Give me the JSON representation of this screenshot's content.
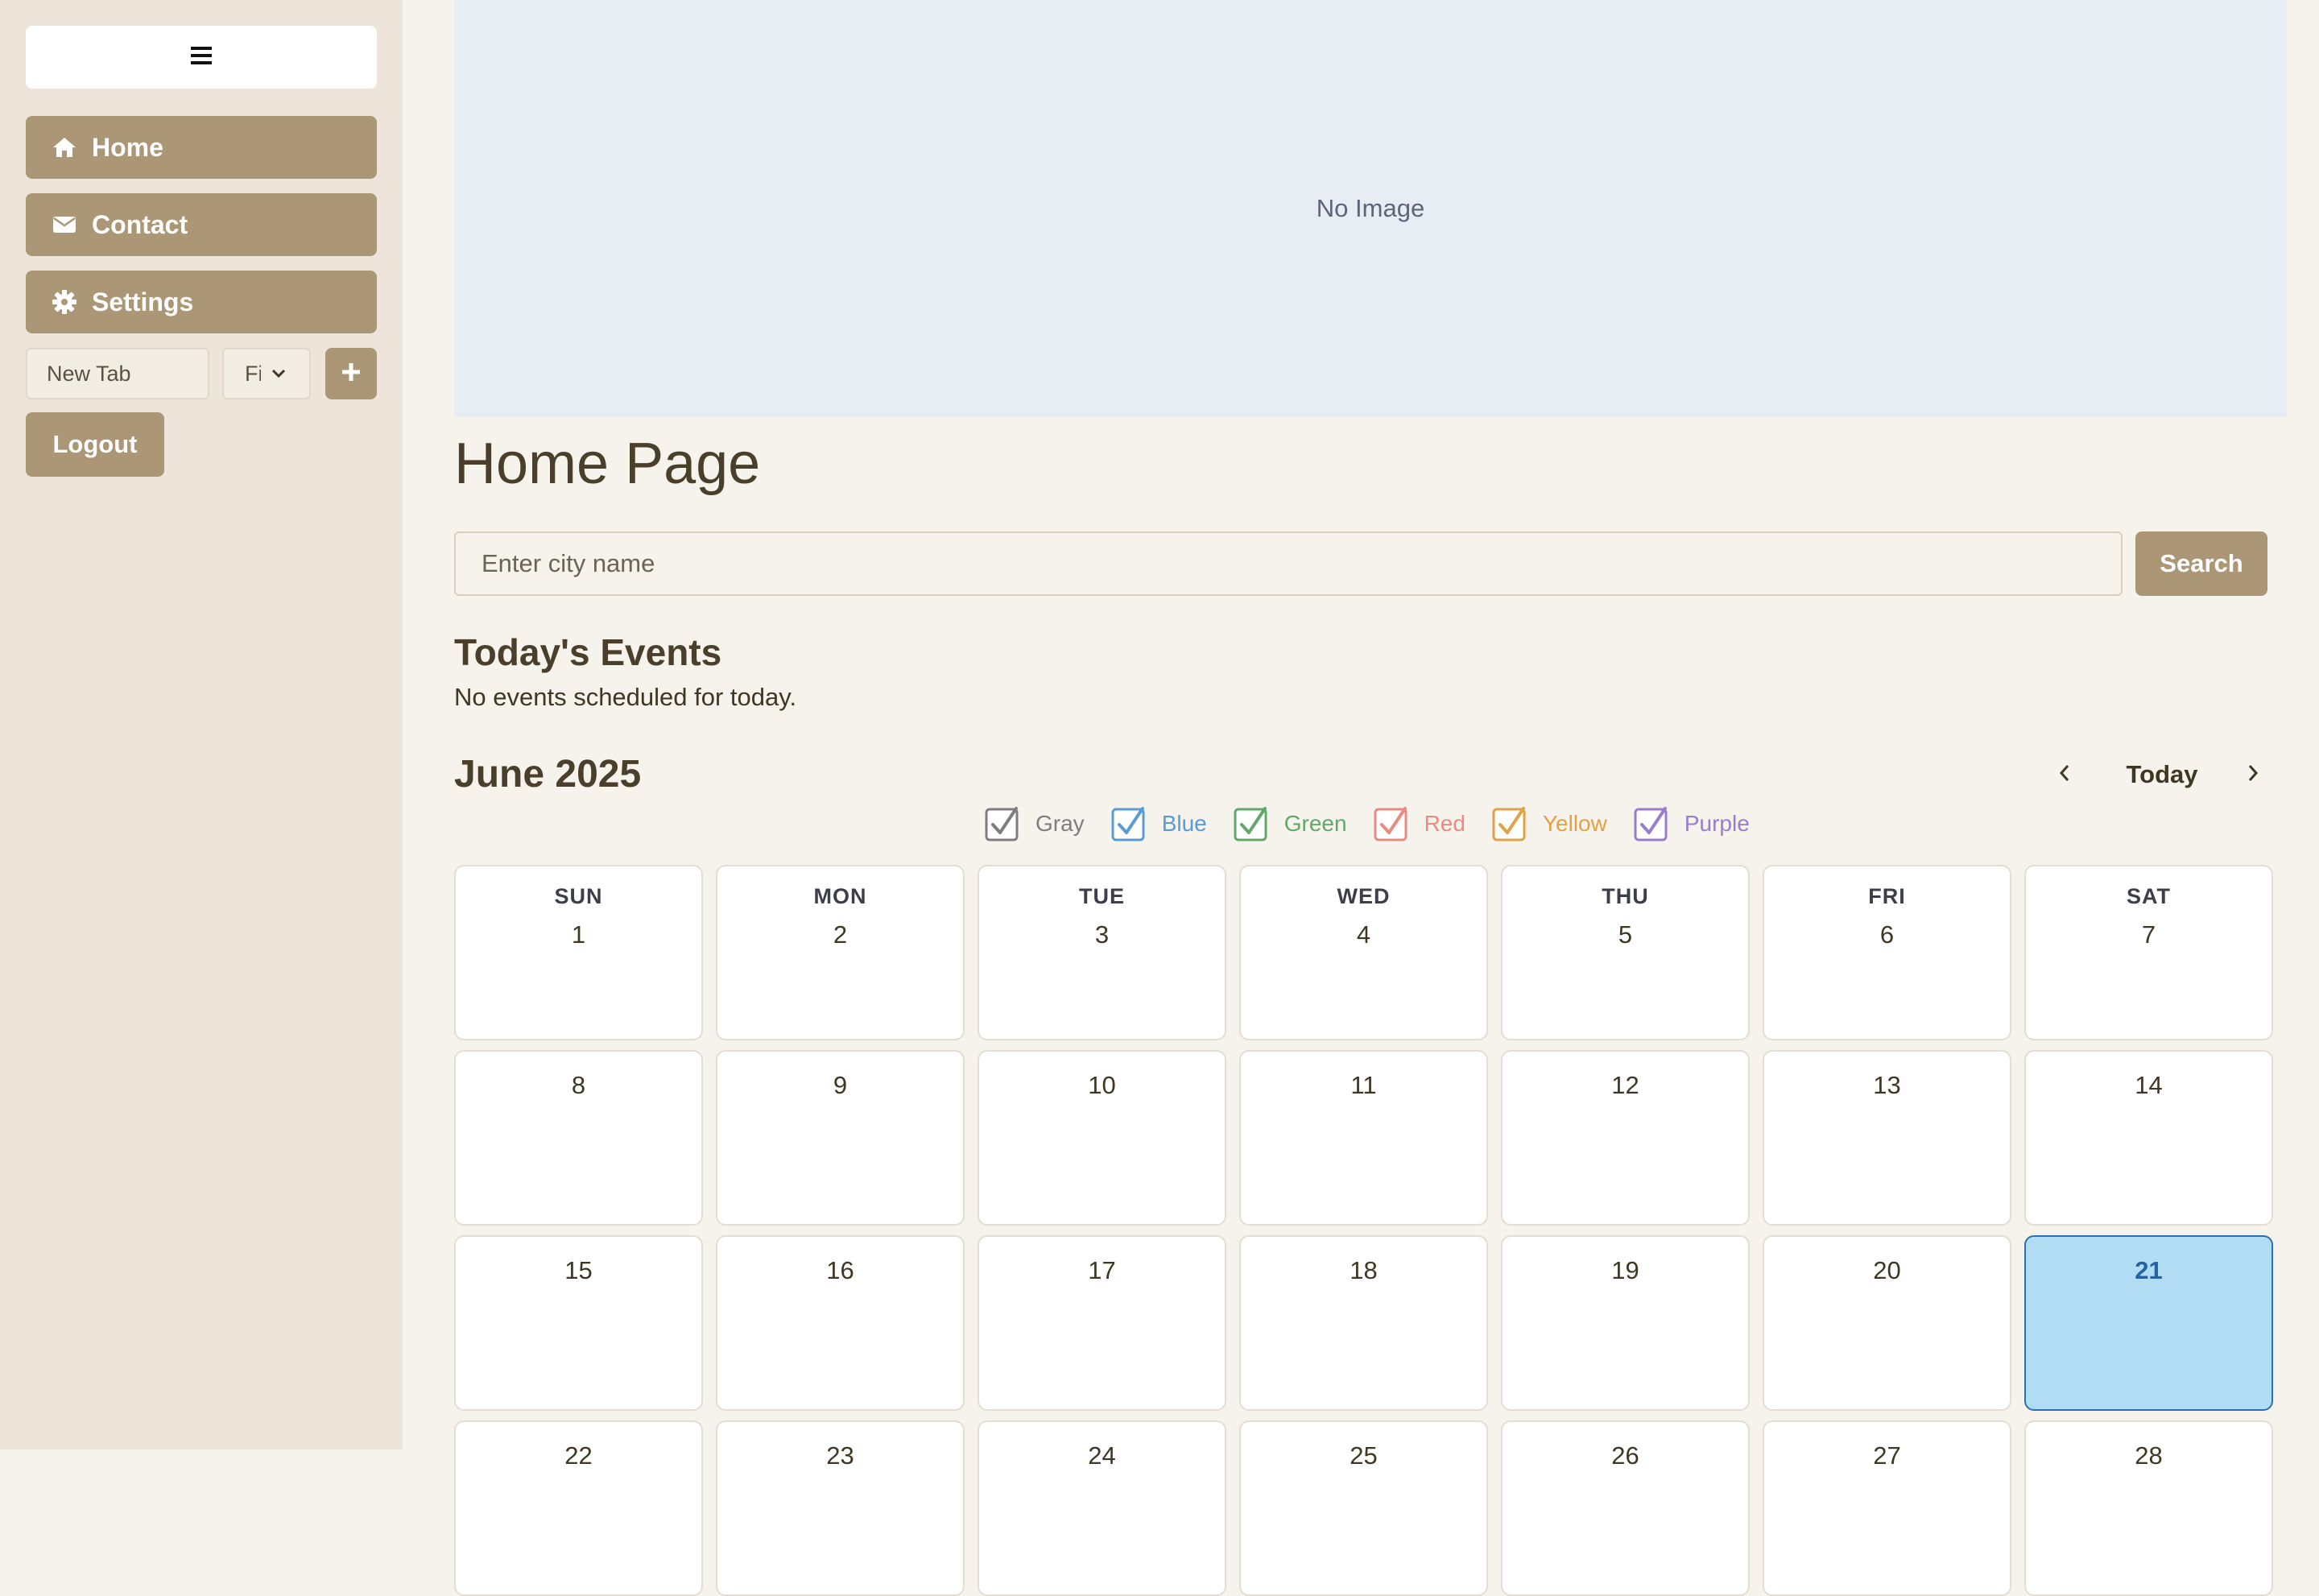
{
  "sidebar": {
    "nav": [
      {
        "label": "Home",
        "icon": "home-icon"
      },
      {
        "label": "Contact",
        "icon": "envelope-icon"
      },
      {
        "label": "Settings",
        "icon": "gear-icon"
      }
    ],
    "tab_input_value": "New Tab",
    "tab_select_value": "Fi",
    "logout_label": "Logout",
    "accent_color": "#ab9775"
  },
  "main": {
    "image_placeholder": "No Image",
    "page_title": "Home Page",
    "search": {
      "placeholder": "Enter city name",
      "button_label": "Search"
    },
    "events": {
      "heading": "Today's Events",
      "empty_text": "No events scheduled for today."
    },
    "calendar": {
      "month_title": "June 2025",
      "today_label": "Today",
      "today_date": 21,
      "filters": [
        {
          "label": "Gray",
          "color": "#7d7d82",
          "checked": true
        },
        {
          "label": "Blue",
          "color": "#5b9bd5",
          "checked": true
        },
        {
          "label": "Green",
          "color": "#62a86a",
          "checked": true
        },
        {
          "label": "Red",
          "color": "#e98a83",
          "checked": true
        },
        {
          "label": "Yellow",
          "color": "#e0a244",
          "checked": true
        },
        {
          "label": "Purple",
          "color": "#9a7ccf",
          "checked": true
        }
      ],
      "weekdays": [
        "SUN",
        "MON",
        "TUE",
        "WED",
        "THU",
        "FRI",
        "SAT"
      ],
      "weeks": [
        [
          "1",
          "2",
          "3",
          "4",
          "5",
          "6",
          "7"
        ],
        [
          "8",
          "9",
          "10",
          "11",
          "12",
          "13",
          "14"
        ],
        [
          "15",
          "16",
          "17",
          "18",
          "19",
          "20",
          "21"
        ],
        [
          "22",
          "23",
          "24",
          "25",
          "26",
          "27",
          "28"
        ]
      ]
    }
  }
}
